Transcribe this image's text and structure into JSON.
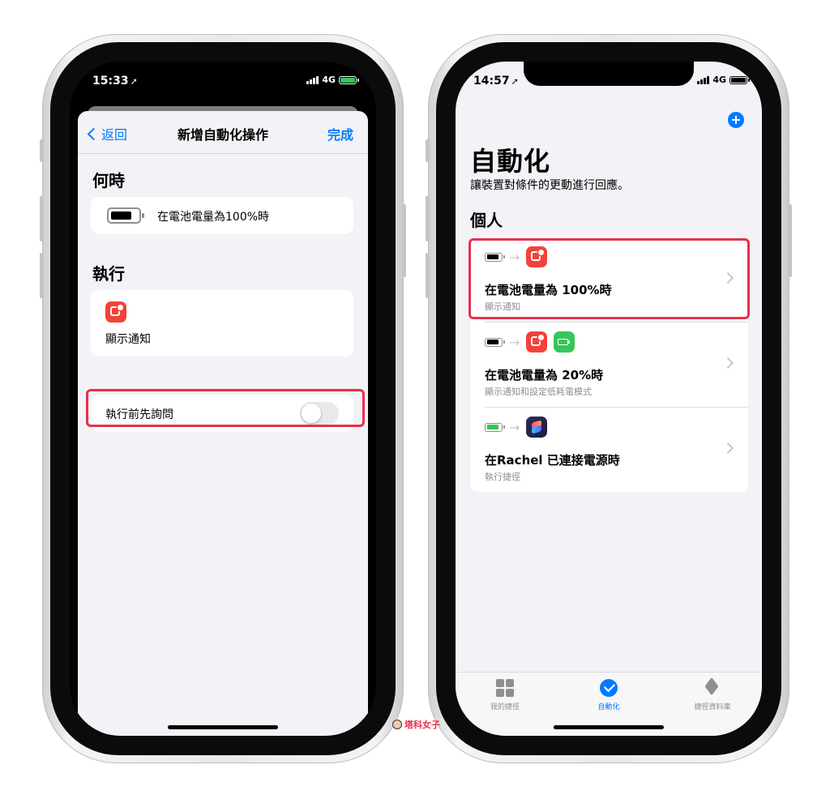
{
  "left_phone": {
    "status": {
      "time": "15:33",
      "network": "4G"
    },
    "nav": {
      "back_label": "返回",
      "title": "新增自動化操作",
      "done_label": "完成"
    },
    "when_section": {
      "title": "何時",
      "condition": "在電池電量為100%時"
    },
    "action_section": {
      "title": "執行",
      "action_icon": "notification-icon",
      "action_label": "顯示通知"
    },
    "ask_before_running": {
      "label": "執行前先詢問",
      "enabled": false
    }
  },
  "right_phone": {
    "status": {
      "time": "14:57",
      "network": "4G"
    },
    "title": "自動化",
    "subtitle": "讓裝置對條件的更動進行回應。",
    "section_title": "個人",
    "automations": [
      {
        "title": "在電池電量為 100%時",
        "subtitle": "顯示通知",
        "icons": [
          "battery-full-icon",
          "notification-icon"
        ]
      },
      {
        "title": "在電池電量為 20%時",
        "subtitle": "顯示通知和設定低耗電模式",
        "icons": [
          "battery-full-icon",
          "notification-icon",
          "low-power-icon"
        ]
      },
      {
        "title": "在Rachel  已連接電源時",
        "subtitle": "執行捷徑",
        "icons": [
          "battery-charging-icon",
          "shortcuts-icon"
        ]
      }
    ],
    "tabs": [
      {
        "label": "我的捷徑",
        "icon": "grid-icon",
        "active": false
      },
      {
        "label": "自動化",
        "icon": "automation-icon",
        "active": true
      },
      {
        "label": "捷徑資料庫",
        "icon": "layers-icon",
        "active": false
      }
    ]
  },
  "watermark": {
    "text": "塔科女子"
  },
  "colors": {
    "accent": "#007aff",
    "highlight": "#e7304b",
    "notification_red": "#f4413a",
    "low_power_green": "#34c759"
  }
}
